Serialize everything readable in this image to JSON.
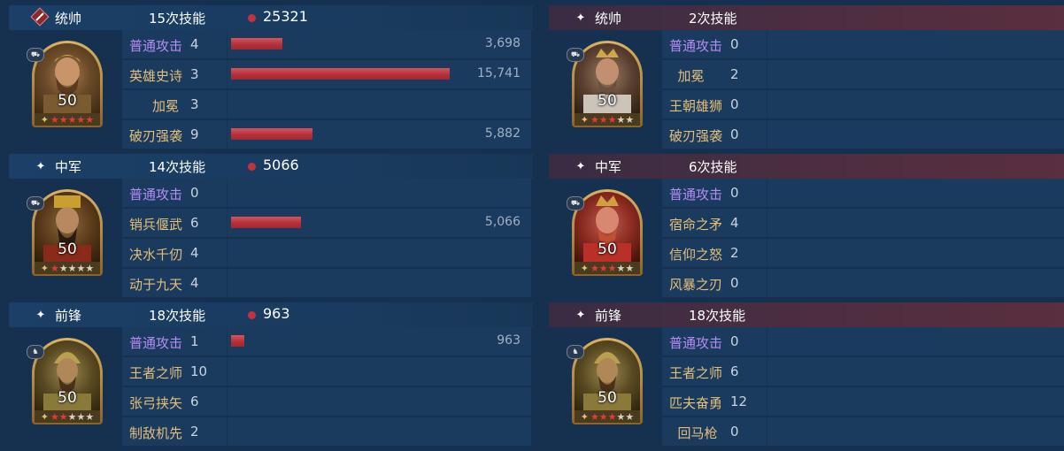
{
  "colors": {
    "accent_red": "#c2333c",
    "purple_skill": "#b38cf4",
    "gold_skill": "#e2bf79"
  },
  "left": {
    "sections": [
      {
        "role": "统帅",
        "count": "15次技能",
        "damage": "25321",
        "icon": "red-badge-icon",
        "hero": {
          "level": "50",
          "stars_filled": 5,
          "stars_total": 5
        },
        "skills": [
          {
            "name": "普通攻击",
            "level": "4",
            "type": "purple",
            "bar": 3698,
            "value": "3,698"
          },
          {
            "name": "英雄史诗",
            "level": "3",
            "type": "gold",
            "bar": 15741,
            "value": "15,741"
          },
          {
            "name": "加冕",
            "level": "3",
            "type": "gold",
            "bar": 0,
            "value": ""
          },
          {
            "name": "破刃强袭",
            "level": "9",
            "type": "gold",
            "bar": 5882,
            "value": "5,882"
          }
        ]
      },
      {
        "role": "中军",
        "count": "14次技能",
        "damage": "5066",
        "icon": "sparkle-icon",
        "hero": {
          "level": "50",
          "stars_filled": 1,
          "stars_total": 5
        },
        "skills": [
          {
            "name": "普通攻击",
            "level": "0",
            "type": "purple",
            "bar": 0,
            "value": ""
          },
          {
            "name": "销兵偃武",
            "level": "6",
            "type": "gold",
            "bar": 5066,
            "value": "5,066"
          },
          {
            "name": "决水千仞",
            "level": "4",
            "type": "gold",
            "bar": 0,
            "value": ""
          },
          {
            "name": "动于九天",
            "level": "4",
            "type": "gold",
            "bar": 0,
            "value": ""
          }
        ]
      },
      {
        "role": "前锋",
        "count": "18次技能",
        "damage": "963",
        "icon": "sparkle-icon",
        "hero": {
          "level": "50",
          "stars_filled": 2,
          "stars_total": 5
        },
        "skills": [
          {
            "name": "普通攻击",
            "level": "1",
            "type": "purple",
            "bar": 963,
            "value": "963"
          },
          {
            "name": "王者之师",
            "level": "10",
            "type": "gold",
            "bar": 0,
            "value": ""
          },
          {
            "name": "张弓挟矢",
            "level": "6",
            "type": "gold",
            "bar": 0,
            "value": ""
          },
          {
            "name": "制敌机先",
            "level": "2",
            "type": "gold",
            "bar": 0,
            "value": ""
          }
        ]
      }
    ]
  },
  "right": {
    "sections": [
      {
        "role": "统帅",
        "count": "2次技能",
        "damage": "",
        "icon": "sparkle-icon",
        "hero": {
          "level": "50",
          "stars_filled": 3,
          "stars_total": 5
        },
        "skills": [
          {
            "name": "普通攻击",
            "level": "0",
            "type": "purple"
          },
          {
            "name": "  加冕",
            "level": "2",
            "type": "gold"
          },
          {
            "name": "王朝雄狮",
            "level": "0",
            "type": "gold"
          },
          {
            "name": "破刃强袭",
            "level": "0",
            "type": "gold"
          }
        ]
      },
      {
        "role": "中军",
        "count": "6次技能",
        "damage": "",
        "icon": "sparkle-icon",
        "hero": {
          "level": "50",
          "stars_filled": 3,
          "stars_total": 5
        },
        "skills": [
          {
            "name": "普通攻击",
            "level": "0",
            "type": "purple"
          },
          {
            "name": "宿命之矛",
            "level": "4",
            "type": "gold"
          },
          {
            "name": "信仰之怒",
            "level": "2",
            "type": "gold"
          },
          {
            "name": "风暴之刃",
            "level": "0",
            "type": "gold"
          }
        ]
      },
      {
        "role": "前锋",
        "count": "18次技能",
        "damage": "",
        "icon": "sparkle-icon",
        "hero": {
          "level": "50",
          "stars_filled": 3,
          "stars_total": 5
        },
        "skills": [
          {
            "name": "普通攻击",
            "level": "0",
            "type": "purple"
          },
          {
            "name": "王者之师",
            "level": "6",
            "type": "gold"
          },
          {
            "name": "匹夫奋勇",
            "level": "12",
            "type": "gold"
          },
          {
            "name": "  回马枪",
            "level": "0",
            "type": "gold"
          }
        ]
      }
    ]
  }
}
